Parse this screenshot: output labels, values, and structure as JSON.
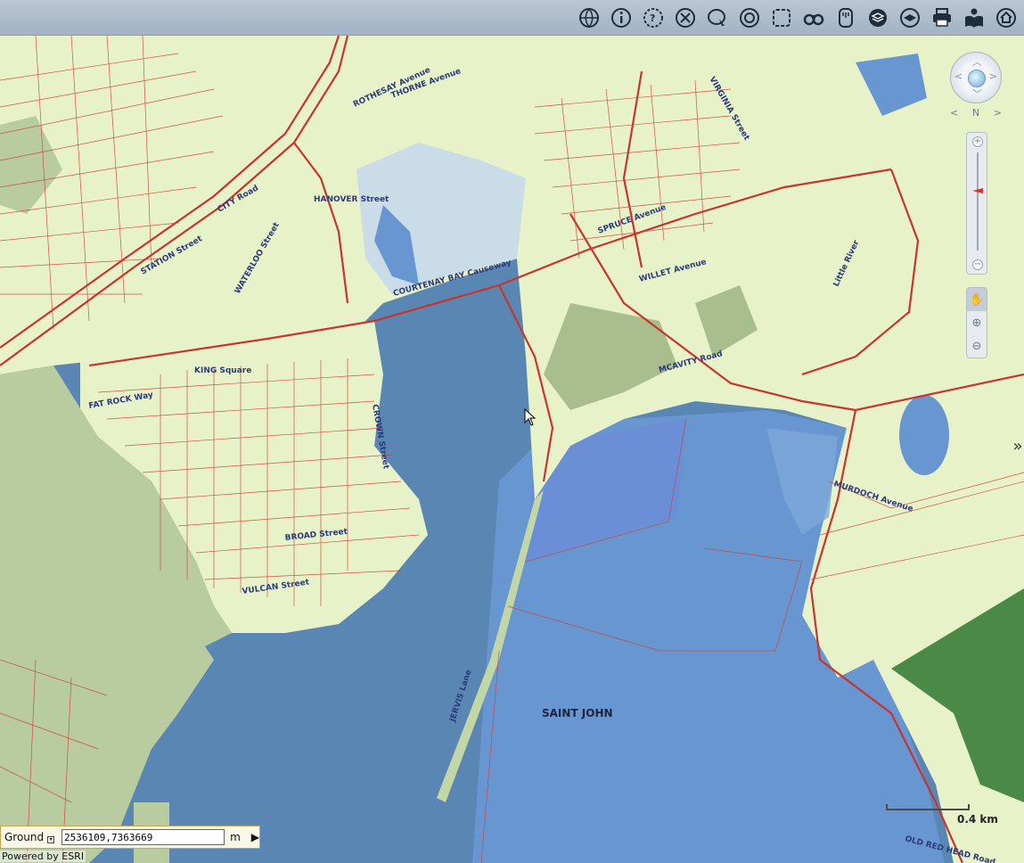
{
  "toolbar": {
    "buttons": [
      {
        "name": "globe-icon",
        "title": "Full extent"
      },
      {
        "name": "info-icon",
        "title": "Identify"
      },
      {
        "name": "query-icon",
        "title": "Query"
      },
      {
        "name": "clear-icon",
        "title": "Clear"
      },
      {
        "name": "select-icon",
        "title": "Select"
      },
      {
        "name": "buffer-icon",
        "title": "Buffer"
      },
      {
        "name": "extent-icon",
        "title": "Zoom to extent"
      },
      {
        "name": "binoculars-icon",
        "title": "Find"
      },
      {
        "name": "measure-icon",
        "title": "Measure"
      },
      {
        "name": "layers-icon",
        "title": "Layers"
      },
      {
        "name": "basemap-icon",
        "title": "Basemap"
      },
      {
        "name": "print-icon",
        "title": "Print"
      },
      {
        "name": "help-icon",
        "title": "Help"
      },
      {
        "name": "home-icon",
        "title": "Home"
      }
    ]
  },
  "map": {
    "labels": {
      "saint_john": "SAINT JOHN",
      "courtenay_bay": "COURTENAY BAY Causeway",
      "hanover": "HANOVER Street",
      "thorne": "THORNE Avenue",
      "rothesay": "ROTHESAY Avenue",
      "spruce": "SPRUCE Avenue",
      "willet": "WILLET Avenue",
      "mcavity": "MCAVITY Road",
      "king": "KING Square",
      "vulcan": "VULCAN Street",
      "broad": "BROAD Street",
      "jervis": "JERVIS Lane",
      "murdoch": "MURDOCH Avenue",
      "old_red_head": "OLD RED HEAD Road",
      "city_road": "CITY Road",
      "station": "STATION Street",
      "waterloo": "WATERLOO Street",
      "crown": "CROWN Street",
      "little_river": "Little River",
      "virginia": "VIRGINIA Street",
      "fatrock": "FAT ROCK Way"
    }
  },
  "nav": {
    "north_label": "N"
  },
  "scalebar": {
    "label": "0.4 km"
  },
  "coords": {
    "ref_label": "Ground",
    "value": "2536109,7363669",
    "unit": "m",
    "go_symbol": "▶"
  },
  "credit": "Powered by ESRI",
  "colors": {
    "water_deep": "#5a86b4",
    "water_light": "#6796d0",
    "land": "#e8f2c8",
    "land_green": "#b8cca0",
    "parcel_line": "#d0403a",
    "toolbar_bg": "#b0bfcf"
  }
}
